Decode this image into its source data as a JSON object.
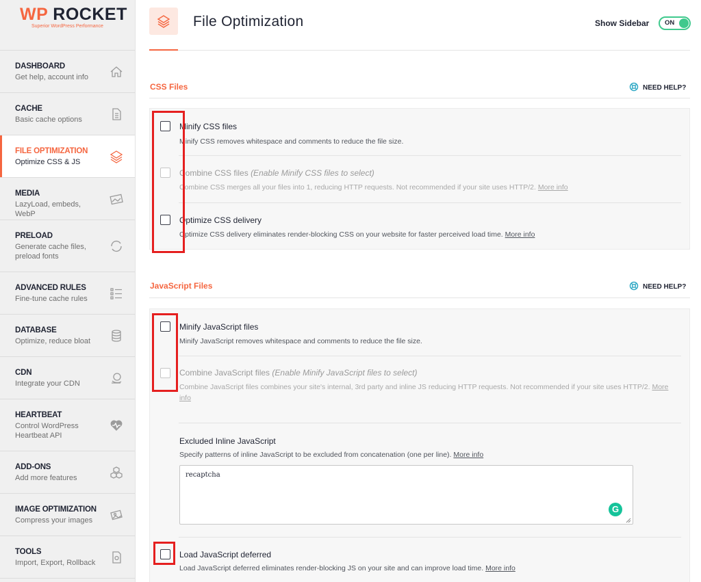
{
  "brand": {
    "name_accent": "WP",
    "name_rest": "ROCKET",
    "tagline": "Superior WordPress Performance"
  },
  "sidebar": {
    "items": [
      {
        "title": "DASHBOARD",
        "subtitle": "Get help, account info",
        "icon": "home-icon"
      },
      {
        "title": "CACHE",
        "subtitle": "Basic cache options",
        "icon": "file-icon"
      },
      {
        "title": "FILE OPTIMIZATION",
        "subtitle": "Optimize CSS & JS",
        "icon": "layers-icon",
        "active": true
      },
      {
        "title": "MEDIA",
        "subtitle": "LazyLoad, embeds, WebP",
        "icon": "image-icon"
      },
      {
        "title": "PRELOAD",
        "subtitle": "Generate cache files, preload fonts",
        "icon": "refresh-icon"
      },
      {
        "title": "ADVANCED RULES",
        "subtitle": "Fine-tune cache rules",
        "icon": "list-icon"
      },
      {
        "title": "DATABASE",
        "subtitle": "Optimize, reduce bloat",
        "icon": "database-icon"
      },
      {
        "title": "CDN",
        "subtitle": "Integrate your CDN",
        "icon": "cdn-icon"
      },
      {
        "title": "HEARTBEAT",
        "subtitle": "Control WordPress Heartbeat API",
        "icon": "heartbeat-icon"
      },
      {
        "title": "ADD-ONS",
        "subtitle": "Add more features",
        "icon": "addons-icon"
      },
      {
        "title": "IMAGE OPTIMIZATION",
        "subtitle": "Compress your images",
        "icon": "image-optimization-icon"
      },
      {
        "title": "TOOLS",
        "subtitle": "Import, Export, Rollback",
        "icon": "tools-icon"
      }
    ]
  },
  "header": {
    "title": "File Optimization",
    "show_sidebar_label": "Show Sidebar",
    "toggle_label": "ON"
  },
  "css_section": {
    "title": "CSS Files",
    "help": "NEED HELP?",
    "options": [
      {
        "label": "Minify CSS files",
        "note": "",
        "description": "Minify CSS removes whitespace and comments to reduce the file size.",
        "link": "",
        "checked": false,
        "disabled": false
      },
      {
        "label": "Combine CSS files",
        "note": "(Enable Minify CSS files to select)",
        "description": "Combine CSS merges all your files into 1, reducing HTTP requests. Not recommended if your site uses HTTP/2.",
        "link": "More info",
        "checked": false,
        "disabled": true
      },
      {
        "label": "Optimize CSS delivery",
        "note": "",
        "description": "Optimize CSS delivery eliminates render-blocking CSS on your website for faster perceived load time.",
        "link": "More info",
        "checked": false,
        "disabled": false
      }
    ]
  },
  "js_section": {
    "title": "JavaScript Files",
    "help": "NEED HELP?",
    "options": [
      {
        "label": "Minify JavaScript files",
        "note": "",
        "description": "Minify JavaScript removes whitespace and comments to reduce the file size.",
        "link": "",
        "checked": false,
        "disabled": false
      },
      {
        "label": "Combine JavaScript files",
        "note": "(Enable Minify JavaScript files to select)",
        "description": "Combine JavaScript files combines your site's internal, 3rd party and inline JS reducing HTTP requests. Not recommended if your site uses HTTP/2.",
        "link": "More info",
        "checked": false,
        "disabled": true
      },
      {
        "label": "Load JavaScript deferred",
        "note": "",
        "description": "Load JavaScript deferred eliminates render-blocking JS on your site and can improve load time.",
        "link": "More info",
        "checked": false,
        "disabled": false
      }
    ],
    "excluded": {
      "title": "Excluded Inline JavaScript",
      "description": "Specify patterns of inline JavaScript to be excluded from concatenation (one per line).",
      "link": "More info",
      "value": "recaptcha"
    }
  },
  "colors": {
    "accent": "#f56640",
    "toggle_on": "#3fc98d",
    "help_icon": "#33aac6",
    "annotation": "#e51f1f",
    "grammarly": "#15c39a"
  }
}
